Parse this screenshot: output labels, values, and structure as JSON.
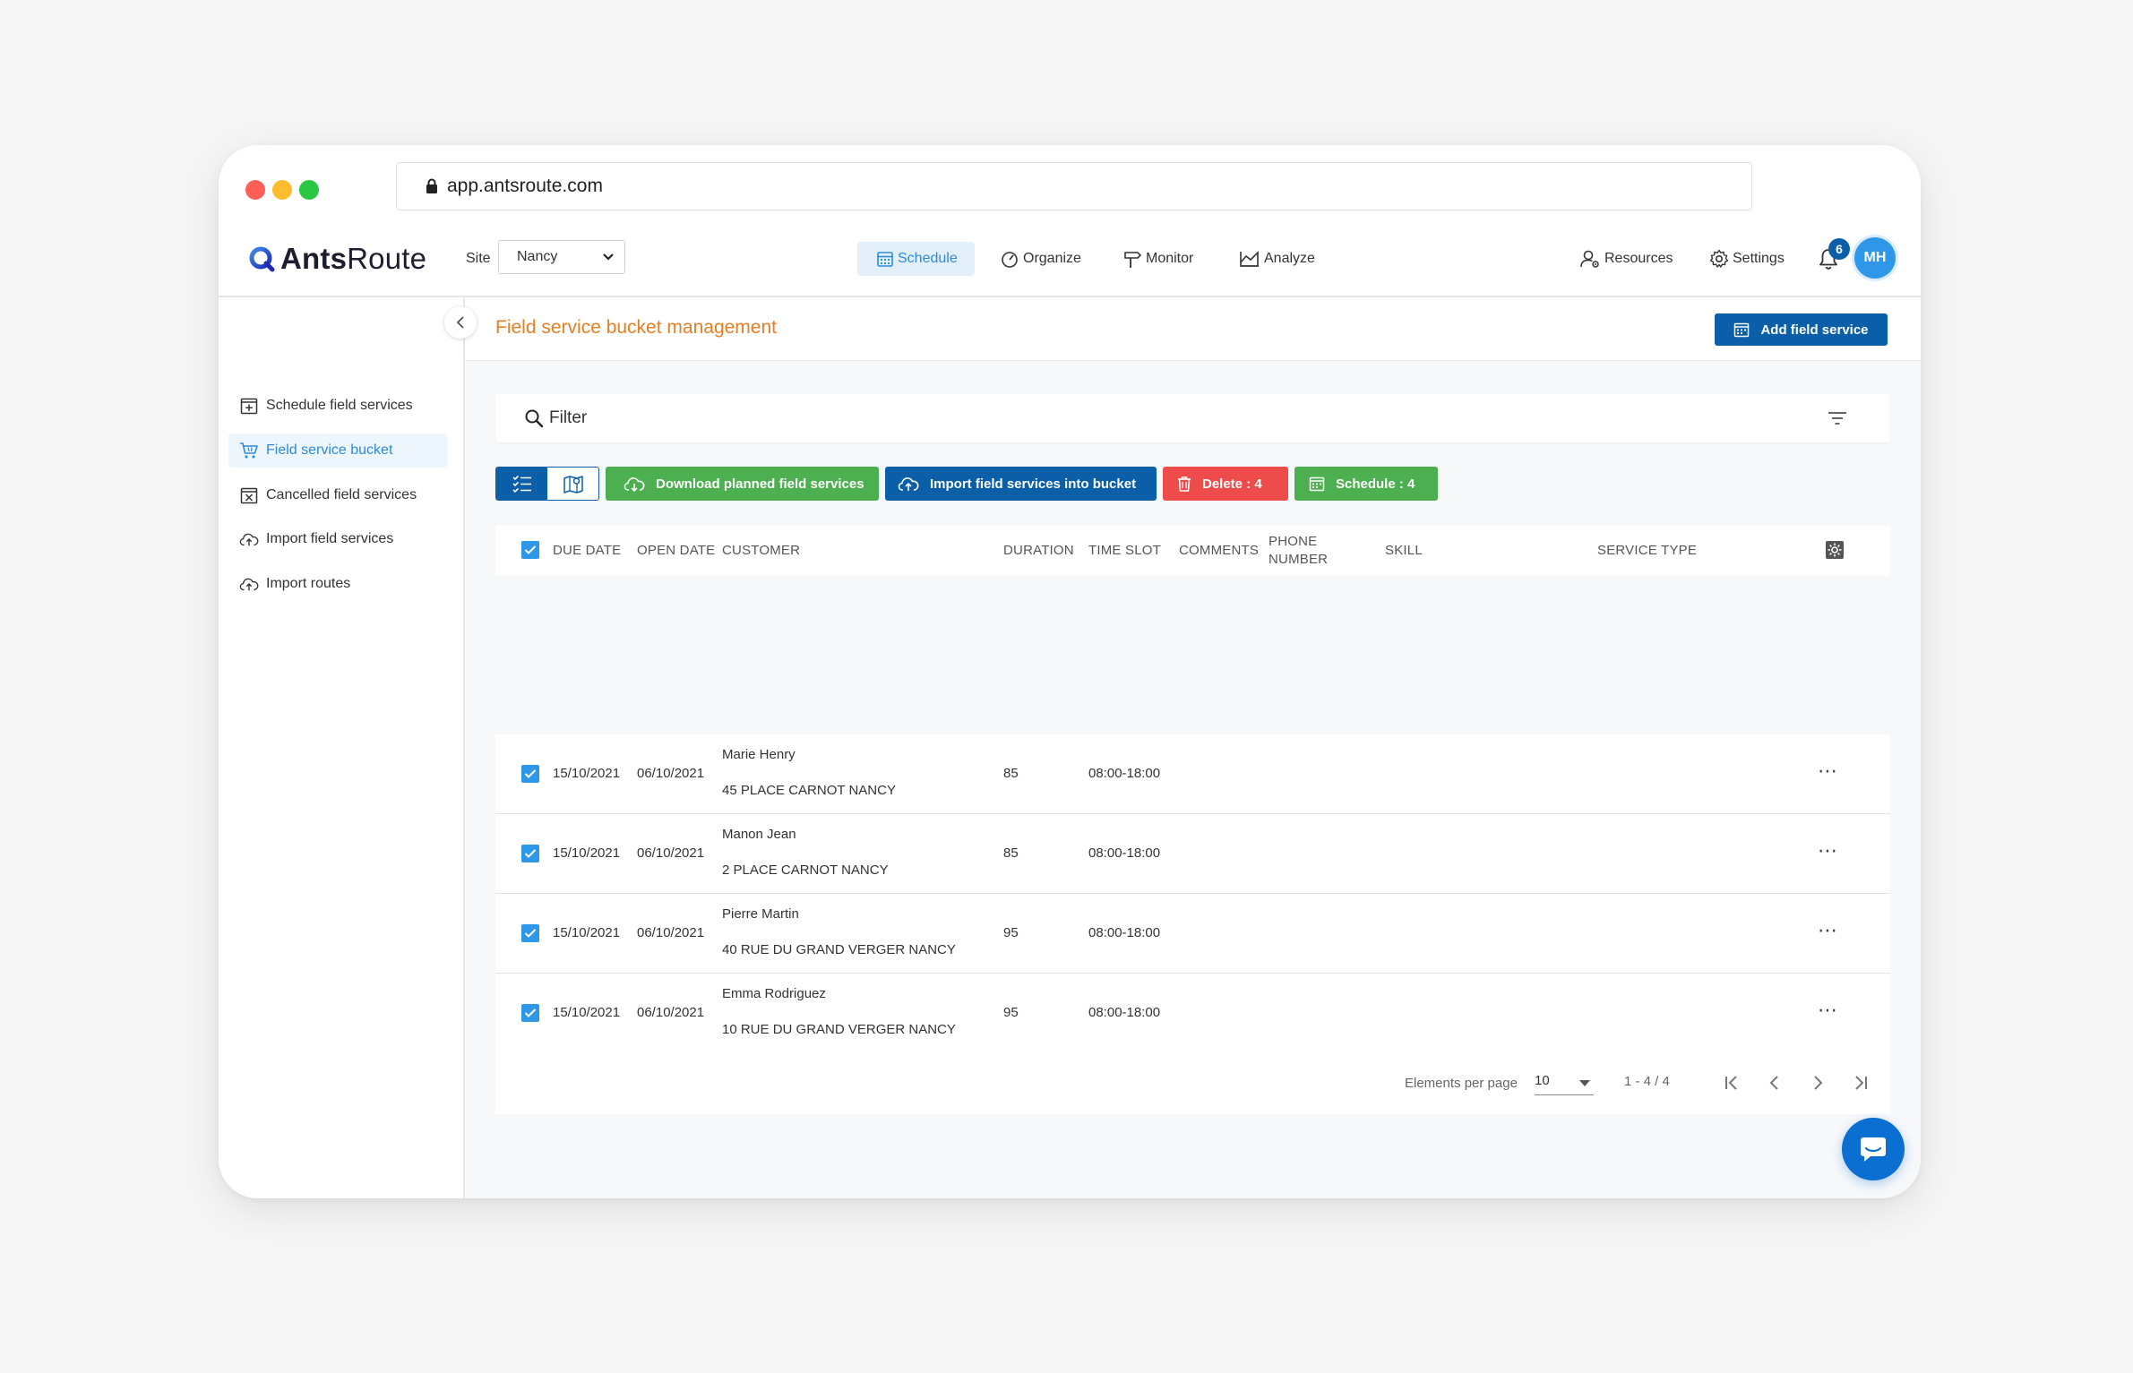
{
  "browser": {
    "url": "app.antsroute.com"
  },
  "app": {
    "logo_bold": "Ants",
    "logo_regular": "Route",
    "site_label": "Site",
    "site_value": "Nancy",
    "nav": [
      {
        "label": "Schedule",
        "icon": "calendar-icon",
        "active": true
      },
      {
        "label": "Organize",
        "icon": "gauge-icon"
      },
      {
        "label": "Monitor",
        "icon": "signpost-icon"
      },
      {
        "label": "Analyze",
        "icon": "chart-icon"
      }
    ],
    "right_nav": [
      {
        "label": "Resources",
        "icon": "user-gear-icon"
      },
      {
        "label": "Settings",
        "icon": "gear-icon"
      }
    ],
    "notifications": "6",
    "avatar_initials": "MH",
    "accent": "#0b5ea8",
    "title_color": "#e67e22"
  },
  "sidebar": {
    "items": [
      {
        "label": "Schedule field services",
        "icon": "calendar-plus-icon"
      },
      {
        "label": "Field service bucket",
        "icon": "cart-icon",
        "active": true
      },
      {
        "label": "Cancelled field services",
        "icon": "calendar-x-icon"
      },
      {
        "label": "Import field services",
        "icon": "cloud-upload-icon"
      },
      {
        "label": "Import routes",
        "icon": "cloud-upload-icon"
      }
    ]
  },
  "page": {
    "title": "Field service bucket management",
    "add_button": "Add field service",
    "filter_placeholder": "Filter"
  },
  "toolbar": {
    "download": "Download planned field services",
    "import": "Import field services into bucket",
    "delete": "Delete : 4",
    "schedule": "Schedule : 4"
  },
  "table": {
    "headers": {
      "due_date": "DUE DATE",
      "open_date": "OPEN DATE",
      "customer": "CUSTOMER",
      "duration": "DURATION",
      "time_slot": "TIME SLOT",
      "comments": "COMMENTS",
      "phone_1": "PHONE",
      "phone_2": "NUMBER",
      "skill": "SKILL",
      "service_type": "SERVICE TYPE"
    },
    "rows": [
      {
        "due": "15/10/2021",
        "open": "06/10/2021",
        "name": "Marie Henry",
        "address": "45 PLACE CARNOT NANCY",
        "duration": "85",
        "slot": "08:00-18:00"
      },
      {
        "due": "15/10/2021",
        "open": "06/10/2021",
        "name": "Manon Jean",
        "address": "2 PLACE CARNOT NANCY",
        "duration": "85",
        "slot": "08:00-18:00"
      },
      {
        "due": "15/10/2021",
        "open": "06/10/2021",
        "name": "Pierre Martin",
        "address": "40 RUE DU GRAND VERGER NANCY",
        "duration": "95",
        "slot": "08:00-18:00"
      },
      {
        "due": "15/10/2021",
        "open": "06/10/2021",
        "name": "Emma Rodriguez",
        "address": "10 RUE DU GRAND VERGER NANCY",
        "duration": "95",
        "slot": "08:00-18:00"
      }
    ]
  },
  "pagination": {
    "per_page_label": "Elements per page",
    "per_page_value": "10",
    "range": "1 - 4 / 4"
  }
}
